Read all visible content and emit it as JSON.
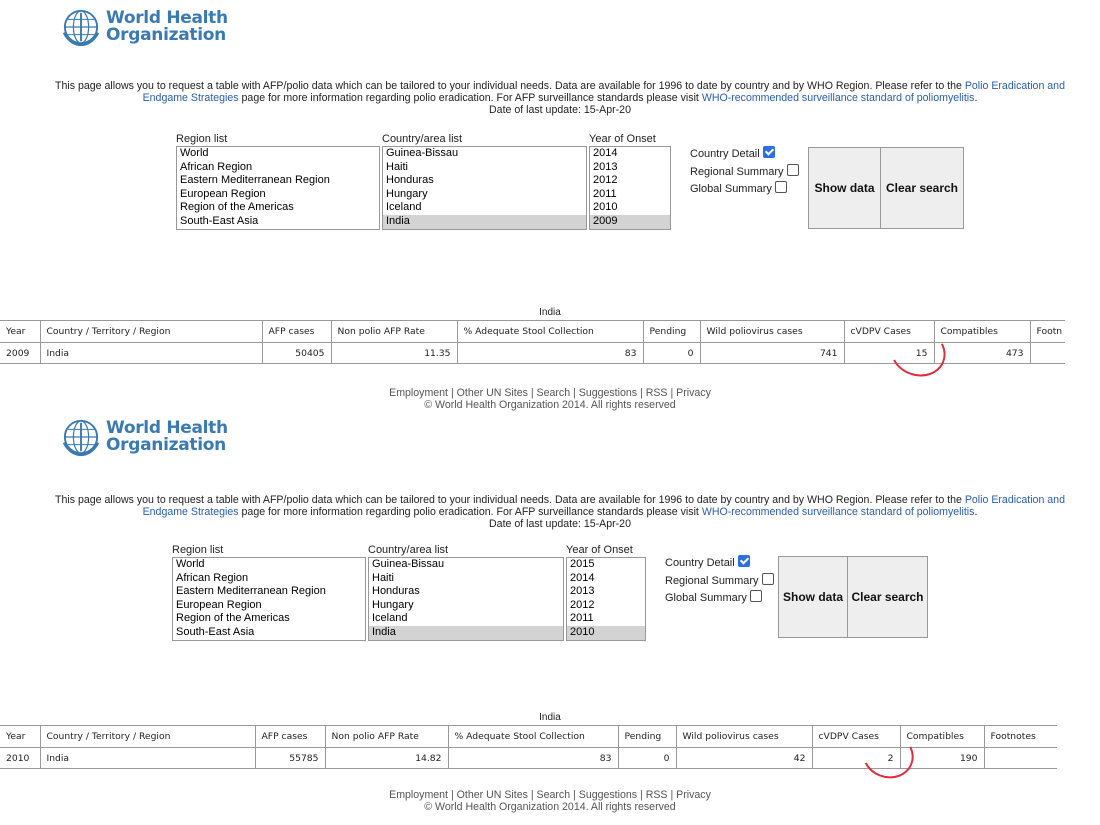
{
  "org": {
    "line1": "World Health",
    "line2": "Organization"
  },
  "intro": {
    "text1": "This page allows you to request a table with AFP/polio data which can be tailored to your individual needs. Data are available for 1996 to date by country and by WHO Region. Please refer to the ",
    "link1": "Polio Eradication and Endgame Strategies",
    "text2": " page for more information regarding polio eradication. For AFP surveillance standards please visit ",
    "link2": "WHO-recommended surveillance standard of poliomyelitis",
    "text3": ".",
    "updated": "Date of last update: 15-Apr-20"
  },
  "labels": {
    "region": "Region list",
    "country": "Country/area list",
    "year": "Year of Onset",
    "country_detail": "Country Detail",
    "regional_summary": "Regional Summary",
    "global_summary": "Global Summary",
    "show": "Show data",
    "clear": "Clear search",
    "table_caption": "India"
  },
  "regions": [
    "World",
    "African Region",
    "Eastern Mediterranean Region",
    "European Region",
    "Region of the Americas",
    "South-East Asia"
  ],
  "countries": [
    "Guinea-Bissau",
    "Haiti",
    "Honduras",
    "Hungary",
    "Iceland",
    "India"
  ],
  "panel1": {
    "years": [
      "2014",
      "2013",
      "2012",
      "2011",
      "2010",
      "2009"
    ],
    "columns": [
      "Year",
      "Country / Territory / Region",
      "AFP cases",
      "Non polio AFP Rate",
      "% Adequate Stool Collection",
      "Pending",
      "Wild poliovirus cases",
      "cVDPV Cases",
      "Compatibles",
      "Footn"
    ],
    "row": [
      "2009",
      "India",
      "50405",
      "11.35",
      "83",
      "0",
      "741",
      "15",
      "473",
      ""
    ]
  },
  "panel2": {
    "years": [
      "2015",
      "2014",
      "2013",
      "2012",
      "2011",
      "2010"
    ],
    "columns": [
      "Year",
      "Country / Territory / Region",
      "AFP cases",
      "Non polio AFP Rate",
      "% Adequate Stool Collection",
      "Pending",
      "Wild poliovirus cases",
      "cVDPV Cases",
      "Compatibles",
      "Footnotes"
    ],
    "row": [
      "2010",
      "India",
      "55785",
      "14.82",
      "83",
      "0",
      "42",
      "2",
      "190",
      ""
    ]
  },
  "footer": {
    "links": [
      "Employment",
      "Other UN Sites",
      "Search",
      "Suggestions",
      "RSS",
      "Privacy"
    ],
    "copyright": "© World Health Organization 2014. All rights reserved"
  },
  "colors": {
    "link": "#2a5db0",
    "logo": "#3a7ab3",
    "highlight_circle": "#e02c3c",
    "selected_row": "#d3d3d3"
  }
}
